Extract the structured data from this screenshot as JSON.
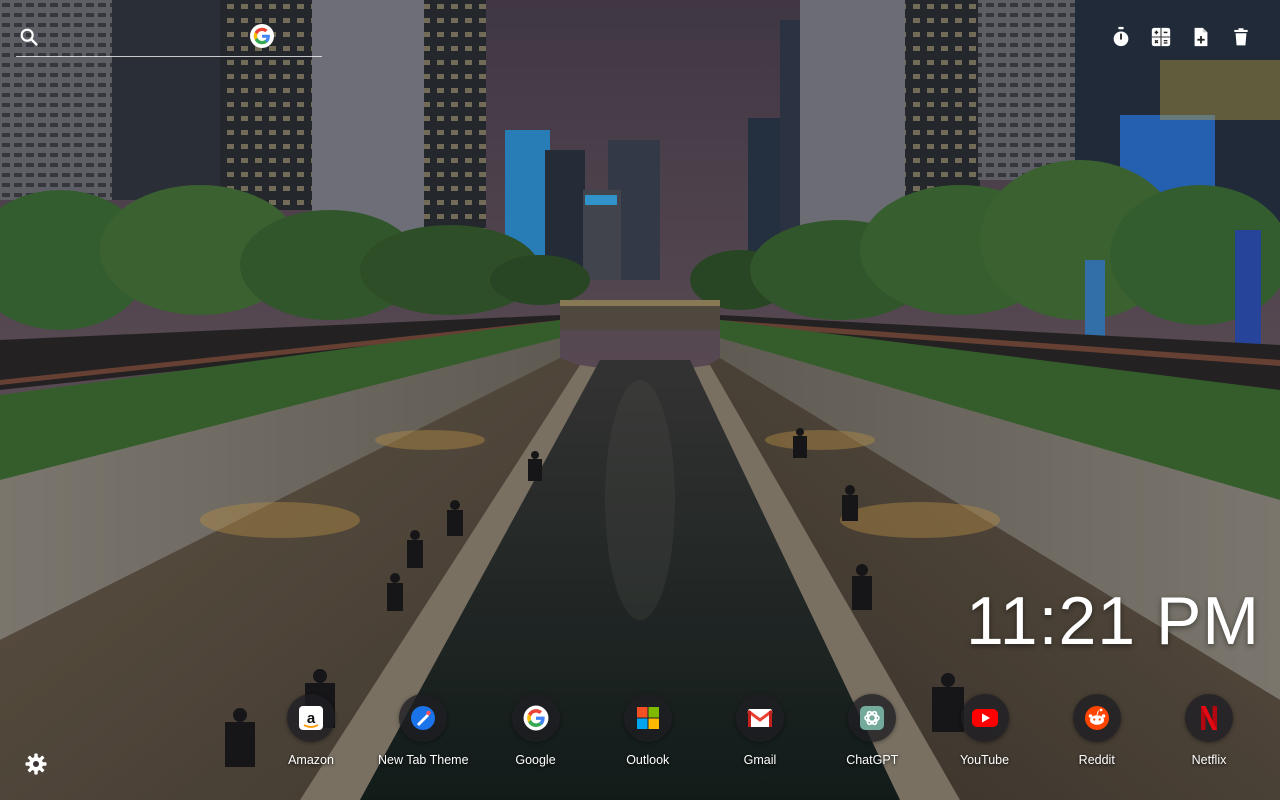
{
  "search": {
    "placeholder": "",
    "engine_icon": "google-g-icon"
  },
  "toolbar": {
    "icons": [
      "timer-icon",
      "calculator-icon",
      "note-add-icon",
      "trash-icon"
    ]
  },
  "clock": {
    "time": "11:21 PM"
  },
  "shortcuts": [
    {
      "label": "Amazon",
      "icon": "amazon-icon",
      "color": "#ffffff"
    },
    {
      "label": "New Tab Theme",
      "icon": "new-tab-theme-icon",
      "color": "#1a73e8"
    },
    {
      "label": "Google",
      "icon": "google-icon",
      "color": "#4285f4"
    },
    {
      "label": "Outlook",
      "icon": "microsoft-icon",
      "color": "#f25022"
    },
    {
      "label": "Gmail",
      "icon": "gmail-icon",
      "color": "#ea4335"
    },
    {
      "label": "ChatGPT",
      "icon": "chatgpt-icon",
      "color": "#74aa9c"
    },
    {
      "label": "YouTube",
      "icon": "youtube-icon",
      "color": "#ff0000"
    },
    {
      "label": "Reddit",
      "icon": "reddit-icon",
      "color": "#ff4500"
    },
    {
      "label": "Netflix",
      "icon": "netflix-icon",
      "color": "#e50914"
    }
  ],
  "settings": {
    "icon": "gear-icon"
  }
}
